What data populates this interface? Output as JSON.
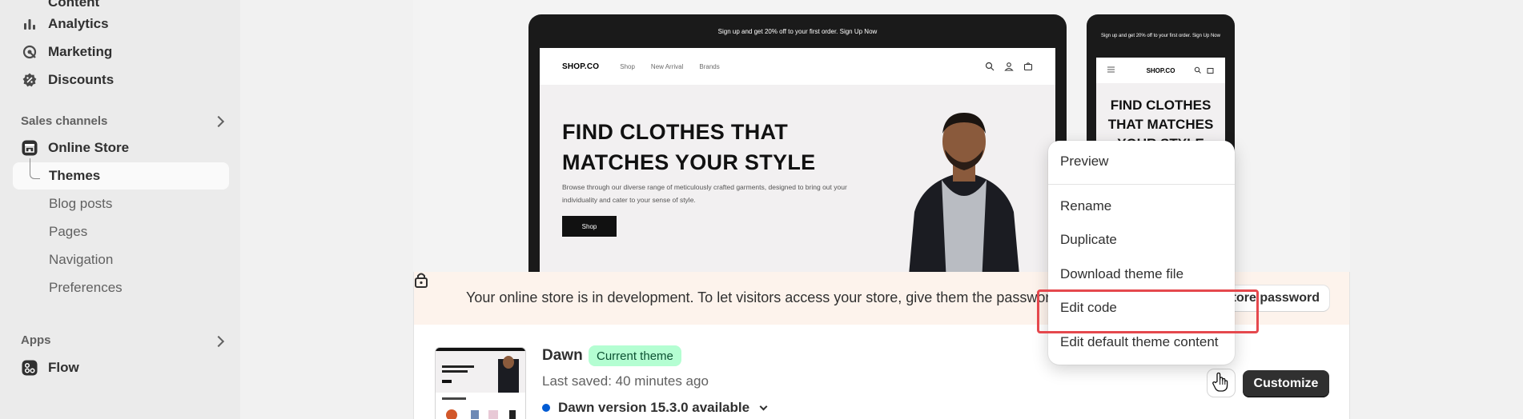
{
  "sidebar": {
    "items": [
      {
        "label": "Content",
        "icon": "content-icon"
      },
      {
        "label": "Analytics",
        "icon": "bar-chart-icon"
      },
      {
        "label": "Marketing",
        "icon": "target-icon"
      },
      {
        "label": "Discounts",
        "icon": "discount-icon"
      }
    ],
    "sales_channels_label": "Sales channels",
    "online_store_label": "Online Store",
    "online_store_sub": [
      "Themes",
      "Blog posts",
      "Pages",
      "Navigation",
      "Preferences"
    ],
    "apps_label": "Apps",
    "flow_label": "Flow"
  },
  "desktop_preview": {
    "promo": "Sign up and get 20% off to your first order. Sign Up Now",
    "logo": "SHOP.CO",
    "nav": [
      "Shop",
      "New Arrival",
      "Brands"
    ],
    "hero_title": "FIND CLOTHES THAT MATCHES YOUR STYLE",
    "hero_desc": "Browse through our diverse range of meticulously crafted garments, designed to bring out your individuality and cater to your sense of style.",
    "hero_button": "Shop"
  },
  "mobile_preview": {
    "promo": "Sign up and get 20% off to your first order. Sign Up Now",
    "logo": "SHOP.CO",
    "hero_title": "FIND CLOTHES THAT MATCHES YOUR STYLE"
  },
  "banner": {
    "text": "Your online store is in development. To let visitors access your store, give them the password.",
    "button": "Store password"
  },
  "theme": {
    "name": "Dawn",
    "badge": "Current theme",
    "last_saved": "Last saved: 40 minutes ago",
    "version": "Dawn version 15.3.0 available",
    "customize": "Customize"
  },
  "menu": {
    "items": [
      "Preview",
      "Rename",
      "Duplicate",
      "Download theme file",
      "Edit code",
      "Edit default theme content"
    ],
    "highlighted": "Edit code"
  },
  "colors": {
    "badge_bg": "#b4fed2",
    "badge_text": "#0c5132",
    "version_dot": "#005bd3",
    "highlight": "#e5484d",
    "banner_bg": "#fdf3ec"
  }
}
